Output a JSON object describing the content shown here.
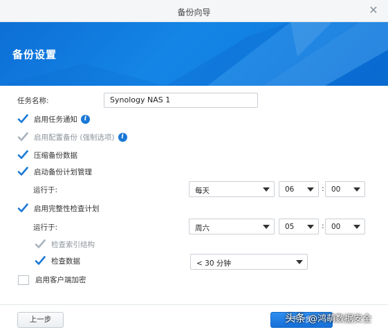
{
  "window": {
    "title": "备份向导"
  },
  "banner": {
    "heading": "备份设置"
  },
  "form": {
    "task_name_label": "任务名称:",
    "task_name_value": "Synology NAS 1",
    "enable_notify": {
      "label": "启用任务通知",
      "checked": true
    },
    "enable_config_backup": {
      "label": "启用配置备份 (强制选项)",
      "checked": true,
      "disabled": true
    },
    "compress_data": {
      "label": "压缩备份数据",
      "checked": true
    },
    "enable_schedule": {
      "label": "启动备份计划管理",
      "checked": true
    },
    "schedule": {
      "run_label": "运行于:",
      "day": "每天",
      "hour": "06",
      "minute": "00",
      "colon": ":"
    },
    "enable_integrity": {
      "label": "启用完整性检查计划",
      "checked": true
    },
    "integrity_schedule": {
      "run_label": "运行于:",
      "day": "周六",
      "hour": "05",
      "minute": "00",
      "colon": ":"
    },
    "check_index": {
      "label": "检查索引结构",
      "checked": true,
      "disabled": true
    },
    "check_data": {
      "label": "检查数据",
      "checked": true
    },
    "check_duration": "< 30 分钟",
    "client_encrypt": {
      "label": "启用客户端加密",
      "checked": false
    }
  },
  "footer": {
    "prev_label": "上一步",
    "next_label": "下一步"
  },
  "watermark": {
    "prefix": "头条",
    "text": " @鸿萌数据安全"
  },
  "colors": {
    "accent": "#1a78d6",
    "banner": "#1485e6",
    "check": "#1a78d6",
    "check_disabled": "#a8b4bf"
  }
}
